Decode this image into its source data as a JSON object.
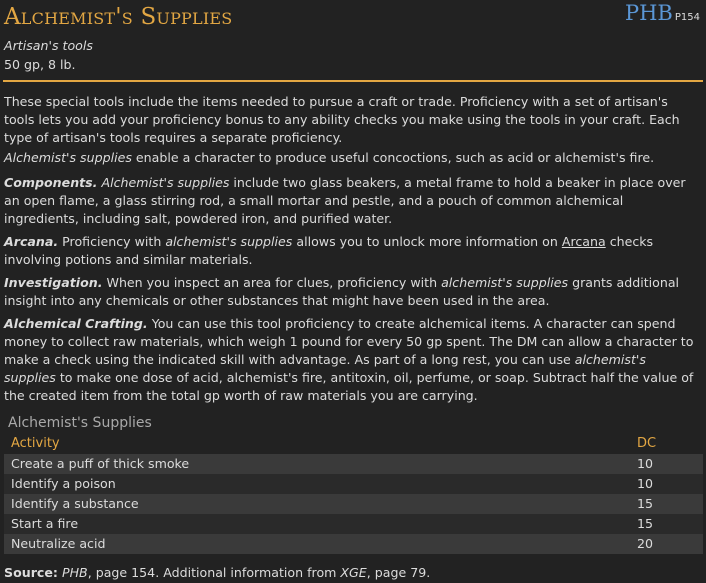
{
  "header": {
    "title": "Alchemist's Supplies",
    "book": "PHB",
    "page": "P154",
    "subtitle": "Artisan's tools",
    "cost_weight": "50 gp, 8 lb."
  },
  "body": {
    "p1": "These special tools include the items needed to pursue a craft or trade. Proficiency with a set of artisan's tools lets you add your proficiency bonus to any ability checks you make using the tools in your craft. Each type of artisan's tools requires a separate proficiency.",
    "p2_name": "Alchemist's supplies",
    "p2_rest": " enable a character to produce useful concoctions, such as acid or alchemist's fire.",
    "components_label": "Components.",
    "components_name": "Alchemist's supplies",
    "components_rest": " include two glass beakers, a metal frame to hold a beaker in place over an open flame, a glass stirring rod, a small mortar and pestle, and a pouch of common alchemical ingredients, including salt, powdered iron, and purified water.",
    "arcana_label": "Arcana.",
    "arcana_pre": " Proficiency with ",
    "arcana_name": "alchemist's supplies",
    "arcana_mid": " allows you to unlock more information on ",
    "arcana_link": "Arcana",
    "arcana_post": " checks involving potions and similar materials.",
    "investigation_label": "Investigation.",
    "investigation_pre": " When you inspect an area for clues, proficiency with ",
    "investigation_name": "alchemist's supplies",
    "investigation_post": " grants additional insight into any chemicals or other substances that might have been used in the area.",
    "crafting_label": "Alchemical Crafting.",
    "crafting_pre": " You can use this tool proficiency to create alchemical items. A character can spend money to collect raw materials, which weigh 1 pound for every 50 gp spent. The DM can allow a character to make a check using the indicated skill with advantage. As part of a long rest, you can use ",
    "crafting_name": "alchemist's supplies",
    "crafting_post": " to make one dose of acid, alchemist's fire, antitoxin, oil, perfume, or soap. Subtract half the value of the created item from the total gp worth of raw materials you are carrying."
  },
  "table": {
    "title": "Alchemist's Supplies",
    "headers": [
      "Activity",
      "DC"
    ],
    "rows": [
      [
        "Create a puff of thick smoke",
        "10"
      ],
      [
        "Identify a poison",
        "10"
      ],
      [
        "Identify a substance",
        "15"
      ],
      [
        "Start a fire",
        "15"
      ],
      [
        "Neutralize acid",
        "20"
      ]
    ]
  },
  "footer": {
    "label": "Source:",
    "book1": "PHB",
    "text1": ", page 154. Additional information from ",
    "book2": "XGE",
    "text2": ", page 79."
  },
  "colors": {
    "accent": "#e3a743",
    "link": "#5b97d6",
    "background": "#222222"
  }
}
